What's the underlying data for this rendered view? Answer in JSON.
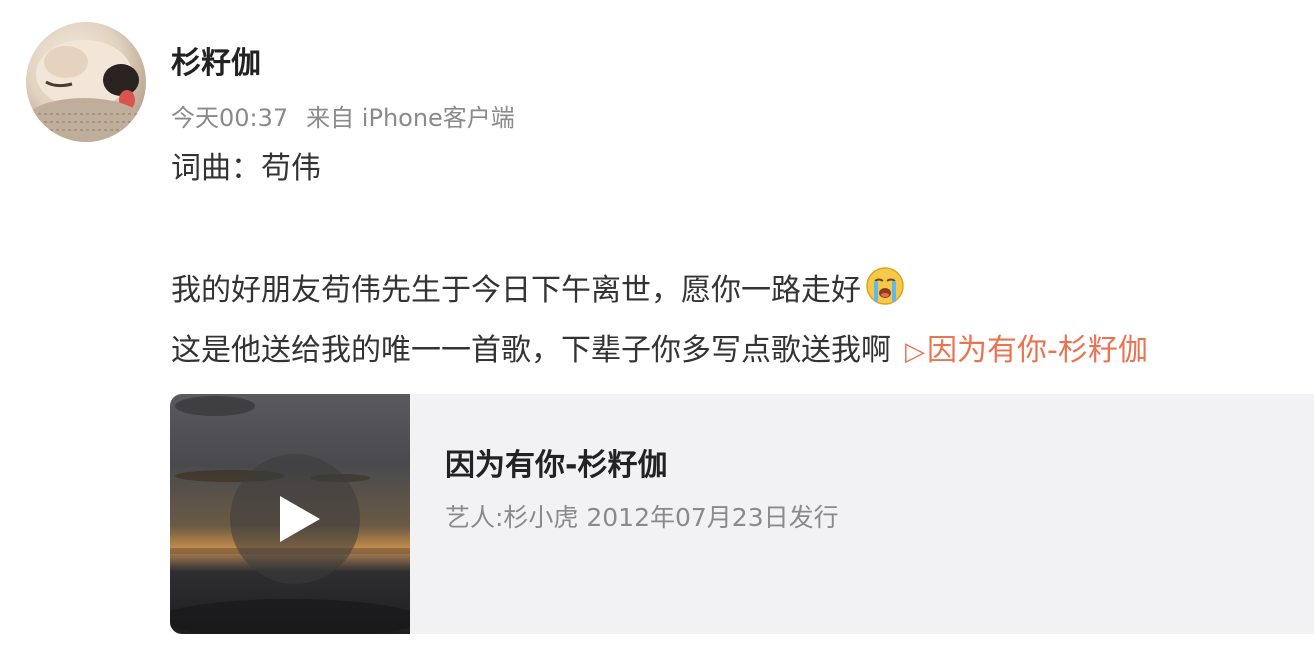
{
  "post": {
    "author": "杉籽伽",
    "time": "今天00:37",
    "source": "来自 iPhone客户端",
    "lines": [
      "词曲：苟伟",
      "我的好朋友苟伟先生于今日下午离世，愿你一路走好",
      "这是他送给我的唯一一首歌，下辈子你多写点歌送我啊"
    ],
    "emoji": "crying-face-icon",
    "music_link": {
      "icon": "play-triangle-icon",
      "label": "因为有你-杉籽伽"
    }
  },
  "music_card": {
    "title": "因为有你-杉籽伽",
    "subtitle": "艺人:杉小虎 2012年07月23日发行",
    "play_icon": "play-icon"
  },
  "colors": {
    "link": "#eb7350",
    "meta": "#8a8a8a",
    "card_bg": "#f2f2f5",
    "text": "#333333"
  }
}
